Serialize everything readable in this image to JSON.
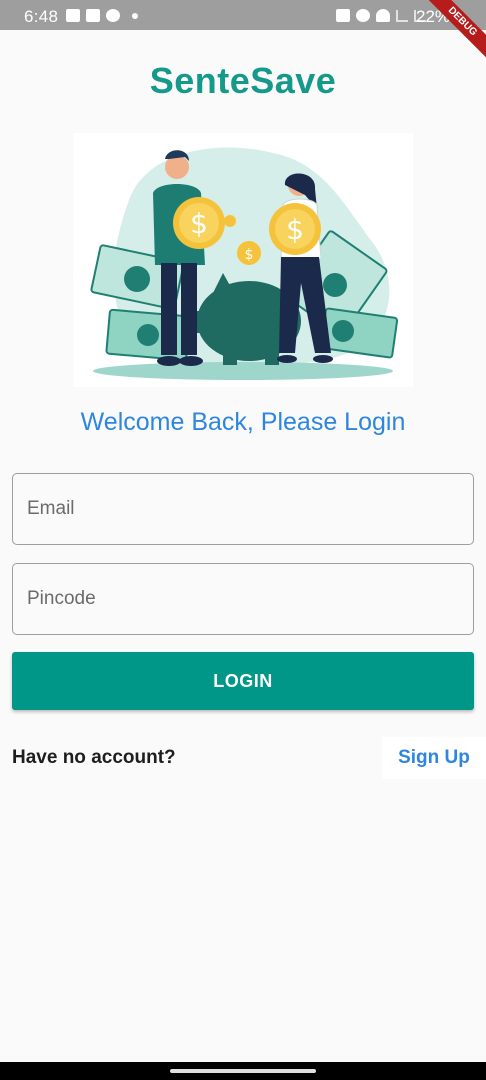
{
  "status_bar": {
    "time": "6:48",
    "battery": "22%",
    "debug_label": "DEBUG",
    "left_icons": [
      "message-icon",
      "image-icon",
      "globe-icon",
      "dot-icon"
    ],
    "right_icons": [
      "nfc-icon",
      "alarm-icon",
      "wifi-icon",
      "signal-icon",
      "signal-icon"
    ]
  },
  "app": {
    "title": "SenteSave",
    "title_color": "#14998a"
  },
  "illustration": {
    "icon": "savings-illustration"
  },
  "login": {
    "welcome_text": "Welcome Back, Please Login",
    "email_placeholder": "Email",
    "email_value": "",
    "pincode_placeholder": "Pincode",
    "pincode_value": "",
    "login_label": "LOGIN",
    "no_account_text": "Have no account?",
    "signup_label": "Sign Up"
  },
  "colors": {
    "primary": "#009688",
    "accent_blue": "#2e86de",
    "background": "#fafafa"
  }
}
